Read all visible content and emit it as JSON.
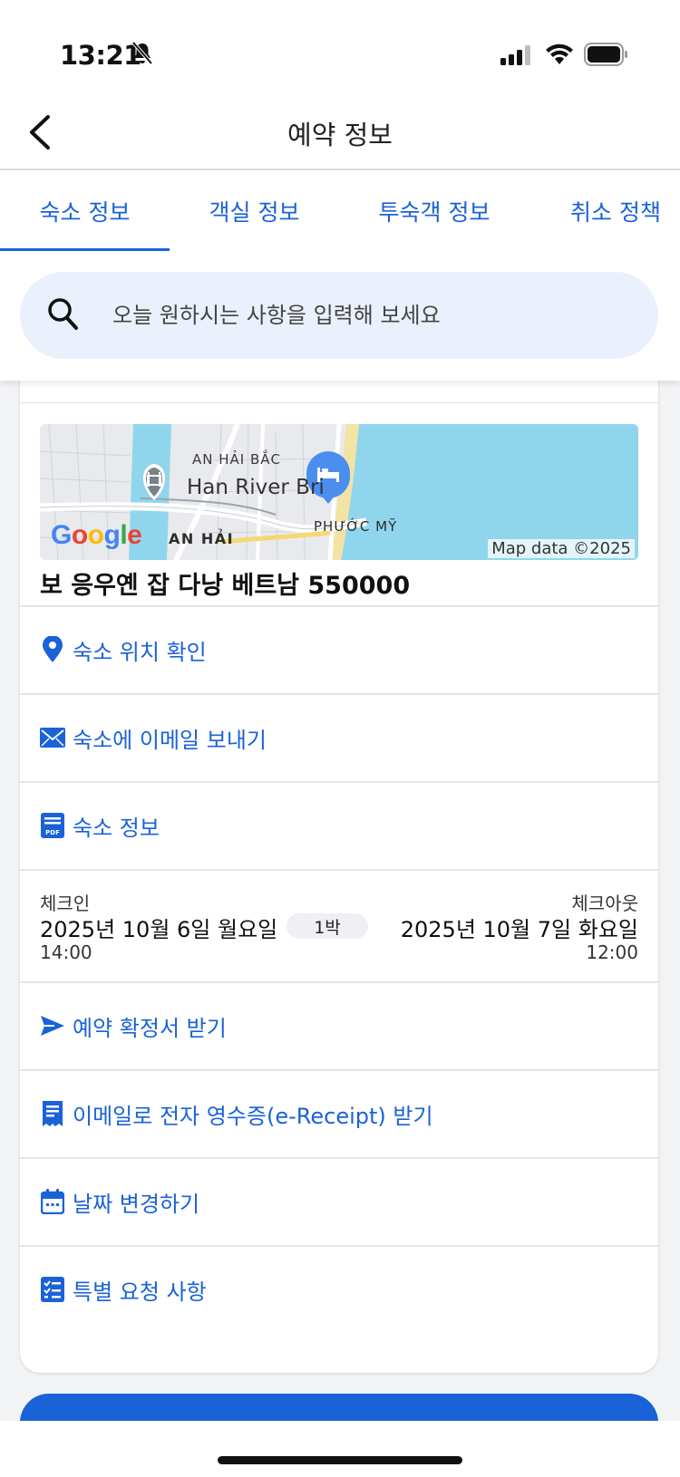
{
  "status_bar": {
    "time": "13:21",
    "icons": [
      "bell-slash-icon",
      "cellular-signal-icon",
      "wifi-icon",
      "battery-icon"
    ]
  },
  "header": {
    "title": "예약 정보",
    "back_icon": "chevron-left-icon"
  },
  "tabs": [
    {
      "label": "숙소 정보",
      "active": true
    },
    {
      "label": "객실 정보",
      "active": false
    },
    {
      "label": "투숙객 정보",
      "active": false
    },
    {
      "label": "취소 정책",
      "active": false
    }
  ],
  "search": {
    "placeholder": "오늘 원하시는 사항을 입력해 보세요",
    "icon": "search-icon"
  },
  "map": {
    "labels": {
      "an_hai_bac": "AN HẢI BẮC",
      "bridge": "Han River Bri",
      "an_hai": "AN HẢI",
      "phuoc_my": "PHƯỚC MỸ"
    },
    "logo": "Google",
    "attribution": "Map data ©2025"
  },
  "hotel": {
    "name": "보 응우옌 잡 다낭 베트남 550000"
  },
  "actions_top": [
    {
      "label": "숙소 위치 확인",
      "icon": "map-pin-icon"
    },
    {
      "label": "숙소에 이메일 보내기",
      "icon": "envelope-icon"
    },
    {
      "label": "숙소 정보",
      "icon": "pdf-document-icon"
    }
  ],
  "stay": {
    "checkin_label": "체크인",
    "checkin_date": "2025년 10월 6일 월요일",
    "checkin_time": "14:00",
    "nights": "1박",
    "checkout_label": "체크아웃",
    "checkout_date": "2025년 10월 7일 화요일",
    "checkout_time": "12:00"
  },
  "actions_bottom": [
    {
      "label": "예약 확정서 받기",
      "icon": "send-icon"
    },
    {
      "label": "이메일로 전자 영수증(e-Receipt) 받기",
      "icon": "receipt-icon"
    },
    {
      "label": "날짜 변경하기",
      "icon": "calendar-icon"
    },
    {
      "label": "특별 요청 사항",
      "icon": "checklist-icon"
    }
  ],
  "colors": {
    "accent": "#1a62d8",
    "search_bg": "#eaf1fc",
    "water": "#8fd6ec",
    "google_blue": "#4285f4",
    "google_red": "#ea4335",
    "google_yellow": "#fbbc05",
    "google_green": "#34a853"
  }
}
